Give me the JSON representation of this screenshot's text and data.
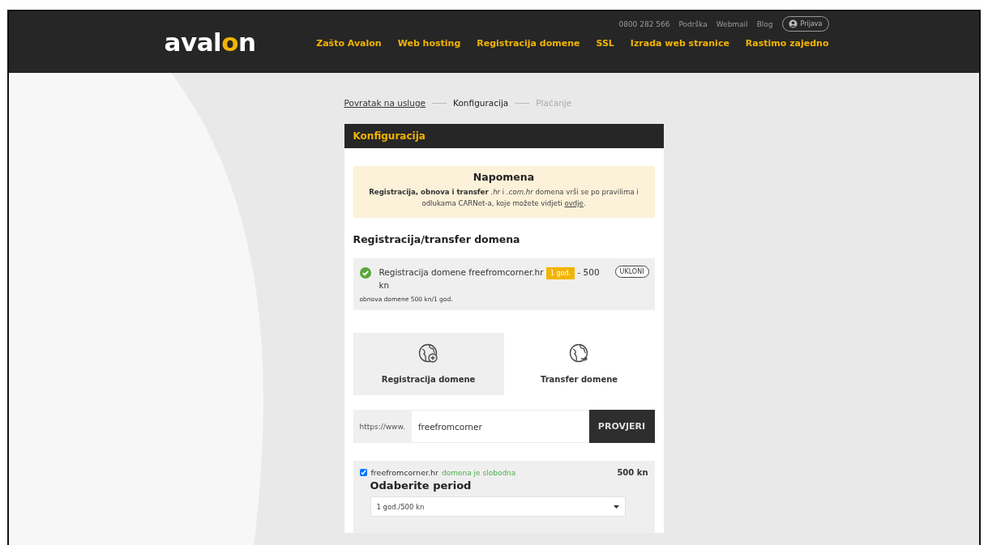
{
  "header": {
    "logo": "avalon",
    "top_links": [
      {
        "label": "0800 282 566"
      },
      {
        "label": "Podrška"
      },
      {
        "label": "Webmail"
      },
      {
        "label": "Blog"
      }
    ],
    "login": "Prijava",
    "nav": [
      {
        "label": "Zašto Avalon"
      },
      {
        "label": "Web hosting"
      },
      {
        "label": "Registracija domene"
      },
      {
        "label": "SSL"
      },
      {
        "label": "Izrada web stranice"
      },
      {
        "label": "Rastimo zajedno"
      }
    ]
  },
  "breadcrumb": [
    {
      "label": "Povratak na usluge",
      "kind": "link"
    },
    {
      "label": "Konfiguracija",
      "kind": "current"
    },
    {
      "label": "Plaćanje",
      "kind": "upcoming"
    }
  ],
  "card": {
    "title": "Konfiguracija",
    "note": {
      "title": "Napomena",
      "text": "**Registracija, obnova i transfer** *.hr* i *.com.hr* domena vrši se po pravilima i odlukama CARNet-a, koje možete vidjeti",
      "link": "ovdje",
      "after": "."
    },
    "section_title": "Registracija/transfer domena",
    "cart_item": {
      "checked": true,
      "text": "Registracija domene freefromcorner.hr",
      "badge": "1 god.",
      "price": "- 500 kn",
      "remove": "UKLONI",
      "renewal": "obnova domene 500 kn/1 god."
    },
    "tabs": [
      {
        "label": "Registracija domene",
        "kind": "register",
        "selected": true
      },
      {
        "label": "Transfer domene",
        "kind": "transfer",
        "selected": false
      }
    ],
    "search": {
      "prefix": "https://www.",
      "value": "freefromcorner",
      "button": "PROVJERI"
    },
    "result": {
      "checked": true,
      "domain": "freefromcorner.hr",
      "status": "domena je slobodna",
      "price": "500 kn",
      "period_label": "Odaberite period",
      "period_value": "1 god./500 kn"
    }
  }
}
